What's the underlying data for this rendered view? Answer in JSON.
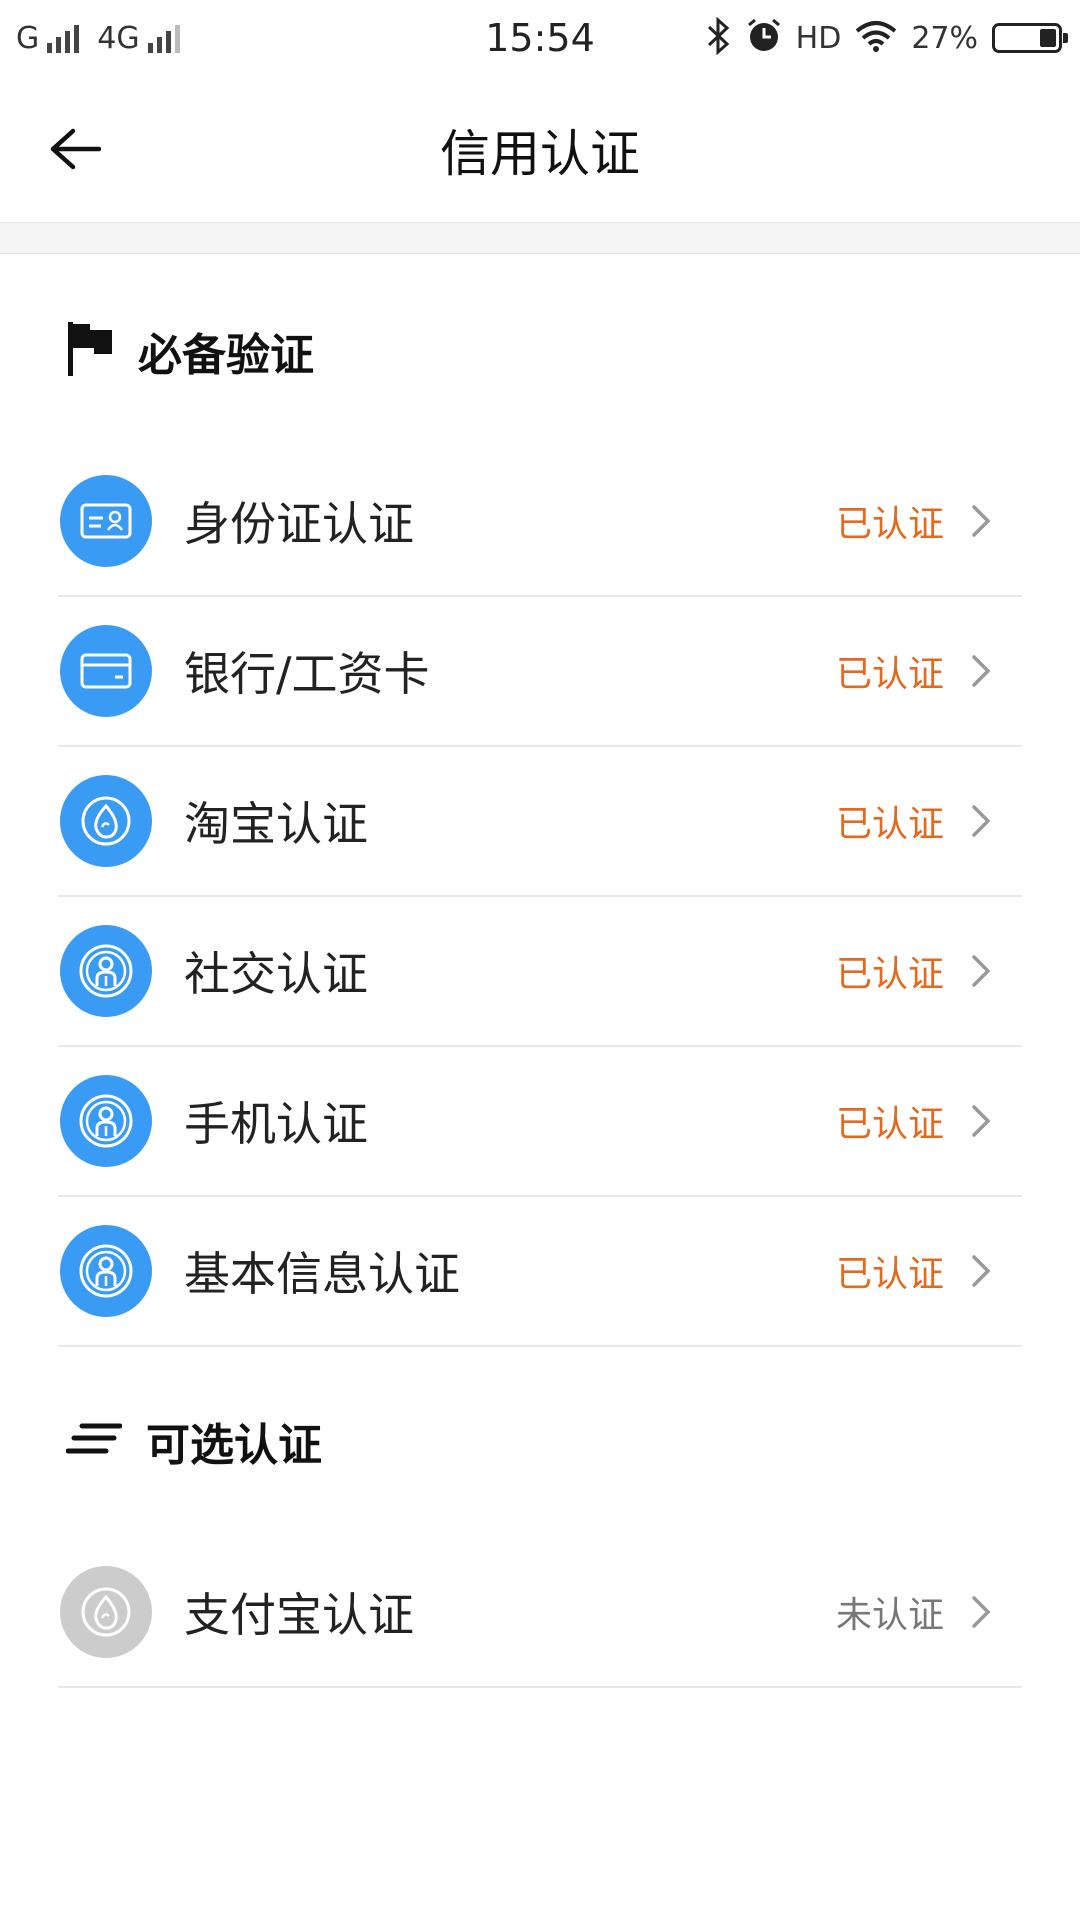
{
  "status_bar": {
    "carrier1": "G",
    "carrier2": "4G",
    "time": "15:54",
    "hd": "HD",
    "battery": "27%",
    "icons": [
      "signal-icon",
      "bluetooth-icon",
      "alarm-icon",
      "wifi-icon",
      "battery-icon"
    ]
  },
  "nav": {
    "title": "信用认证",
    "back_icon": "arrow-left-icon"
  },
  "required_section": {
    "title": "必备验证",
    "icon": "flag-icon",
    "items": [
      {
        "label": "身份证认证",
        "status": "已认证",
        "icon": "id-card-icon"
      },
      {
        "label": "银行/工资卡",
        "status": "已认证",
        "icon": "bank-card-icon"
      },
      {
        "label": "淘宝认证",
        "status": "已认证",
        "icon": "taobao-icon"
      },
      {
        "label": "社交认证",
        "status": "已认证",
        "icon": "person-badge-icon"
      },
      {
        "label": "手机认证",
        "status": "已认证",
        "icon": "person-badge-icon"
      },
      {
        "label": "基本信息认证",
        "status": "已认证",
        "icon": "person-badge-icon"
      }
    ]
  },
  "optional_section": {
    "title": "可选认证",
    "icon": "lines-icon",
    "items": [
      {
        "label": "支付宝认证",
        "status": "未认证",
        "icon": "alipay-icon"
      }
    ]
  },
  "colors": {
    "icon_active": "#3a9bf5",
    "icon_inactive": "#cccccc",
    "status_done": "#e2691d",
    "status_pending": "#777777"
  }
}
